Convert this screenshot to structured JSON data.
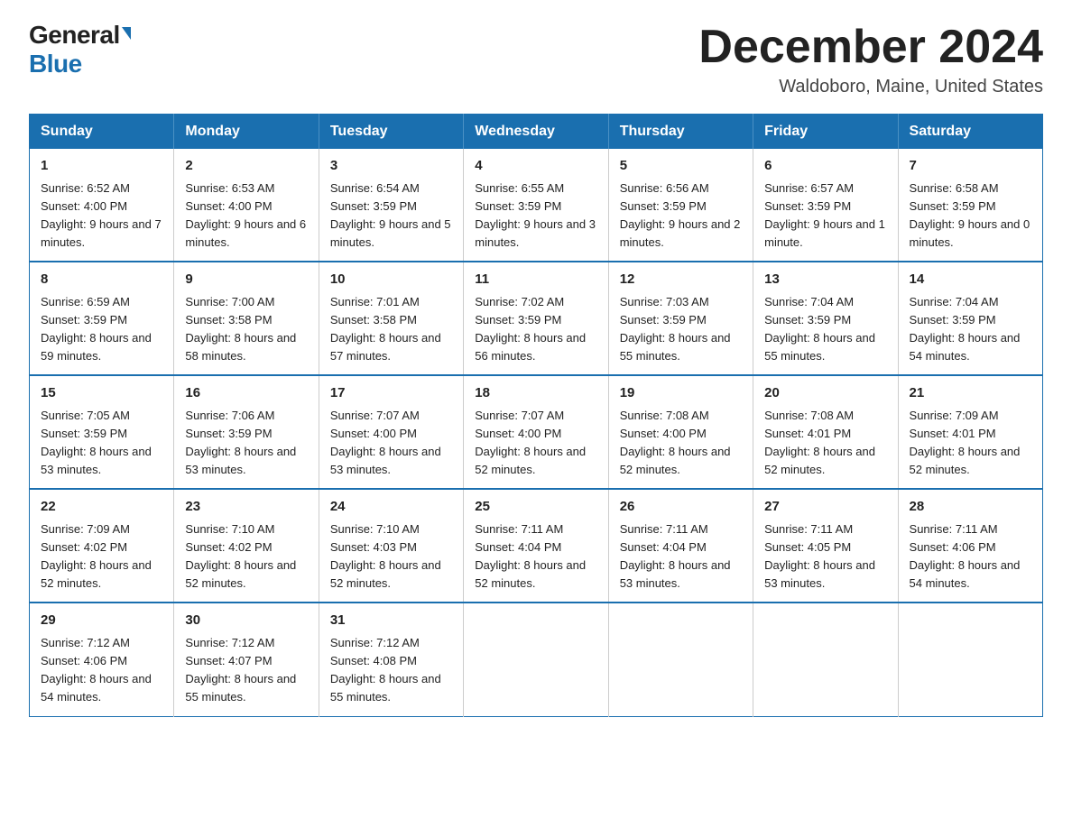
{
  "header": {
    "logo_general": "General",
    "logo_blue": "Blue",
    "title": "December 2024",
    "location": "Waldoboro, Maine, United States"
  },
  "days_of_week": [
    "Sunday",
    "Monday",
    "Tuesday",
    "Wednesday",
    "Thursday",
    "Friday",
    "Saturday"
  ],
  "weeks": [
    [
      {
        "day": "1",
        "sunrise": "6:52 AM",
        "sunset": "4:00 PM",
        "daylight": "9 hours and 7 minutes."
      },
      {
        "day": "2",
        "sunrise": "6:53 AM",
        "sunset": "4:00 PM",
        "daylight": "9 hours and 6 minutes."
      },
      {
        "day": "3",
        "sunrise": "6:54 AM",
        "sunset": "3:59 PM",
        "daylight": "9 hours and 5 minutes."
      },
      {
        "day": "4",
        "sunrise": "6:55 AM",
        "sunset": "3:59 PM",
        "daylight": "9 hours and 3 minutes."
      },
      {
        "day": "5",
        "sunrise": "6:56 AM",
        "sunset": "3:59 PM",
        "daylight": "9 hours and 2 minutes."
      },
      {
        "day": "6",
        "sunrise": "6:57 AM",
        "sunset": "3:59 PM",
        "daylight": "9 hours and 1 minute."
      },
      {
        "day": "7",
        "sunrise": "6:58 AM",
        "sunset": "3:59 PM",
        "daylight": "9 hours and 0 minutes."
      }
    ],
    [
      {
        "day": "8",
        "sunrise": "6:59 AM",
        "sunset": "3:59 PM",
        "daylight": "8 hours and 59 minutes."
      },
      {
        "day": "9",
        "sunrise": "7:00 AM",
        "sunset": "3:58 PM",
        "daylight": "8 hours and 58 minutes."
      },
      {
        "day": "10",
        "sunrise": "7:01 AM",
        "sunset": "3:58 PM",
        "daylight": "8 hours and 57 minutes."
      },
      {
        "day": "11",
        "sunrise": "7:02 AM",
        "sunset": "3:59 PM",
        "daylight": "8 hours and 56 minutes."
      },
      {
        "day": "12",
        "sunrise": "7:03 AM",
        "sunset": "3:59 PM",
        "daylight": "8 hours and 55 minutes."
      },
      {
        "day": "13",
        "sunrise": "7:04 AM",
        "sunset": "3:59 PM",
        "daylight": "8 hours and 55 minutes."
      },
      {
        "day": "14",
        "sunrise": "7:04 AM",
        "sunset": "3:59 PM",
        "daylight": "8 hours and 54 minutes."
      }
    ],
    [
      {
        "day": "15",
        "sunrise": "7:05 AM",
        "sunset": "3:59 PM",
        "daylight": "8 hours and 53 minutes."
      },
      {
        "day": "16",
        "sunrise": "7:06 AM",
        "sunset": "3:59 PM",
        "daylight": "8 hours and 53 minutes."
      },
      {
        "day": "17",
        "sunrise": "7:07 AM",
        "sunset": "4:00 PM",
        "daylight": "8 hours and 53 minutes."
      },
      {
        "day": "18",
        "sunrise": "7:07 AM",
        "sunset": "4:00 PM",
        "daylight": "8 hours and 52 minutes."
      },
      {
        "day": "19",
        "sunrise": "7:08 AM",
        "sunset": "4:00 PM",
        "daylight": "8 hours and 52 minutes."
      },
      {
        "day": "20",
        "sunrise": "7:08 AM",
        "sunset": "4:01 PM",
        "daylight": "8 hours and 52 minutes."
      },
      {
        "day": "21",
        "sunrise": "7:09 AM",
        "sunset": "4:01 PM",
        "daylight": "8 hours and 52 minutes."
      }
    ],
    [
      {
        "day": "22",
        "sunrise": "7:09 AM",
        "sunset": "4:02 PM",
        "daylight": "8 hours and 52 minutes."
      },
      {
        "day": "23",
        "sunrise": "7:10 AM",
        "sunset": "4:02 PM",
        "daylight": "8 hours and 52 minutes."
      },
      {
        "day": "24",
        "sunrise": "7:10 AM",
        "sunset": "4:03 PM",
        "daylight": "8 hours and 52 minutes."
      },
      {
        "day": "25",
        "sunrise": "7:11 AM",
        "sunset": "4:04 PM",
        "daylight": "8 hours and 52 minutes."
      },
      {
        "day": "26",
        "sunrise": "7:11 AM",
        "sunset": "4:04 PM",
        "daylight": "8 hours and 53 minutes."
      },
      {
        "day": "27",
        "sunrise": "7:11 AM",
        "sunset": "4:05 PM",
        "daylight": "8 hours and 53 minutes."
      },
      {
        "day": "28",
        "sunrise": "7:11 AM",
        "sunset": "4:06 PM",
        "daylight": "8 hours and 54 minutes."
      }
    ],
    [
      {
        "day": "29",
        "sunrise": "7:12 AM",
        "sunset": "4:06 PM",
        "daylight": "8 hours and 54 minutes."
      },
      {
        "day": "30",
        "sunrise": "7:12 AM",
        "sunset": "4:07 PM",
        "daylight": "8 hours and 55 minutes."
      },
      {
        "day": "31",
        "sunrise": "7:12 AM",
        "sunset": "4:08 PM",
        "daylight": "8 hours and 55 minutes."
      },
      null,
      null,
      null,
      null
    ]
  ]
}
